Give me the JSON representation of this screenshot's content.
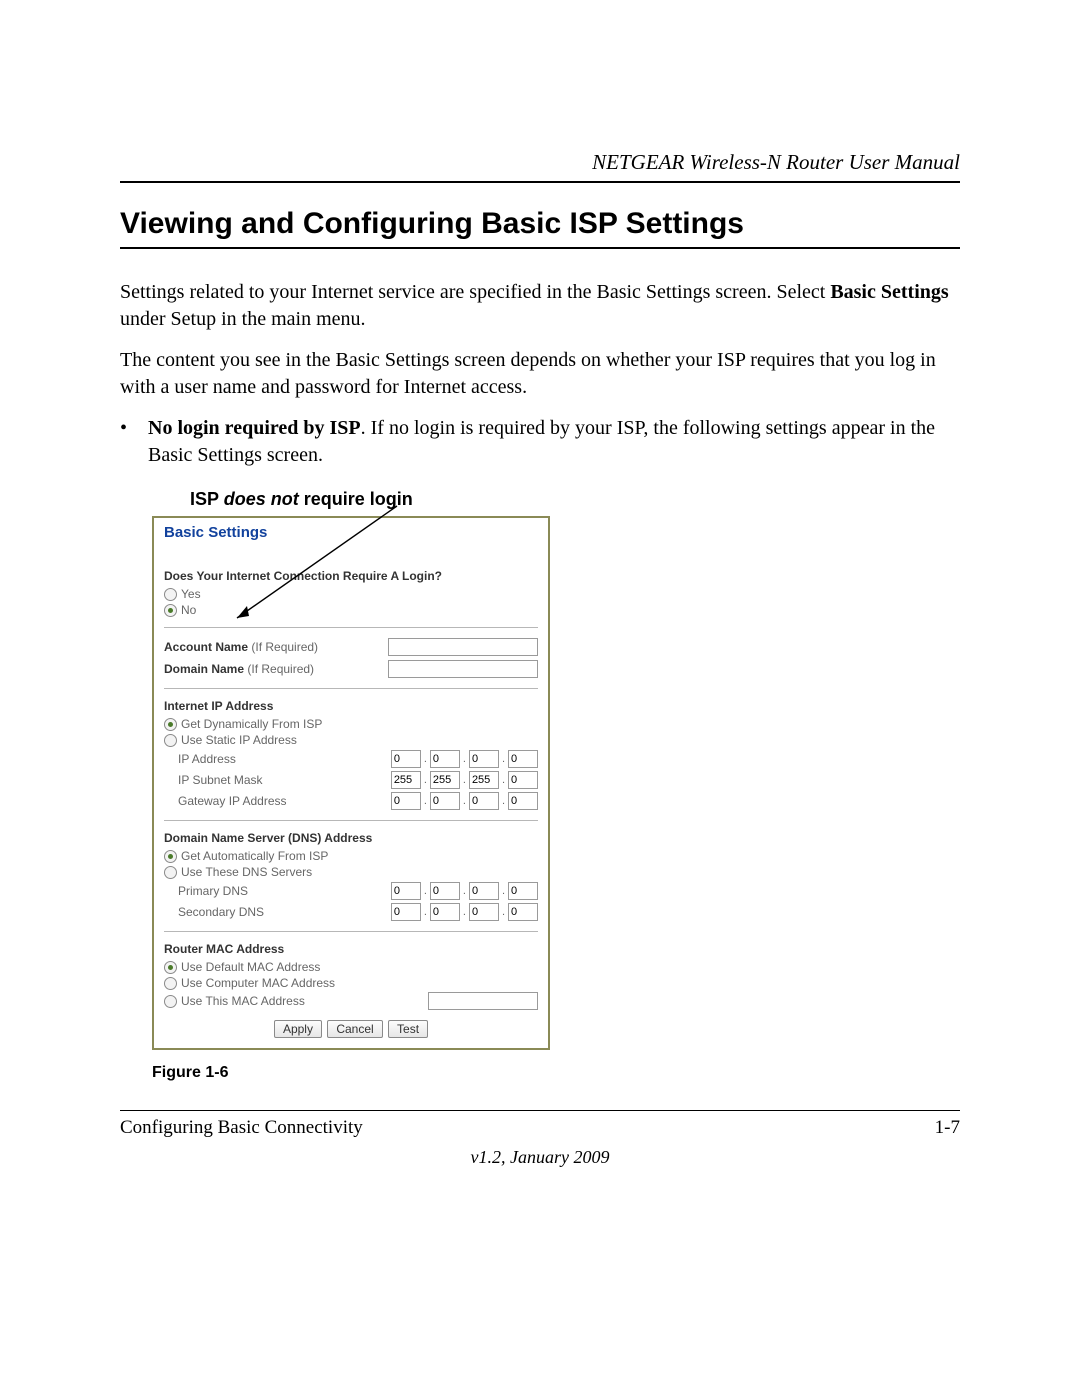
{
  "header": {
    "title": "NETGEAR Wireless-N Router User Manual"
  },
  "section": {
    "heading": "Viewing and Configuring Basic ISP Settings",
    "p1_a": "Settings related to your Internet service are specified in the Basic Settings screen. Select ",
    "p1_b_bold": "Basic Settings",
    "p1_c": " under Setup in the main menu.",
    "p2": "The content you see in the Basic Settings screen depends on whether your ISP requires that you log in with a user name and password for Internet access.",
    "bullet": {
      "lead_bold": "No login required by ISP",
      "rest": ". If no login is required by your ISP, the following settings appear in the Basic Settings screen."
    },
    "callout_a": "ISP ",
    "callout_em": "does not",
    "callout_b": " require login"
  },
  "panel": {
    "title": "Basic Settings",
    "login_q": "Does Your Internet Connection Require A Login?",
    "opt_yes": "Yes",
    "opt_no": "No",
    "account_label": "Account Name",
    "if_required": " (If Required)",
    "domain_label": "Domain Name",
    "internet_ip_head": "Internet IP Address",
    "opt_dyn_isp": "Get Dynamically From ISP",
    "opt_static_ip": "Use Static IP Address",
    "ip_address_label": "IP Address",
    "ip_subnet_label": "IP Subnet Mask",
    "gateway_label": "Gateway IP Address",
    "ip_addr": [
      "0",
      "0",
      "0",
      "0"
    ],
    "subnet": [
      "255",
      "255",
      "255",
      "0"
    ],
    "gateway": [
      "0",
      "0",
      "0",
      "0"
    ],
    "dns_head": "Domain Name Server (DNS) Address",
    "opt_dns_auto": "Get Automatically From ISP",
    "opt_dns_these": "Use These DNS Servers",
    "primary_dns_label": "Primary DNS",
    "secondary_dns_label": "Secondary DNS",
    "primary_dns": [
      "0",
      "0",
      "0",
      "0"
    ],
    "secondary_dns": [
      "0",
      "0",
      "0",
      "0"
    ],
    "mac_head": "Router MAC Address",
    "opt_mac_default": "Use Default MAC Address",
    "opt_mac_computer": "Use Computer MAC Address",
    "opt_mac_this": "Use This MAC Address",
    "btn_apply": "Apply",
    "btn_cancel": "Cancel",
    "btn_test": "Test"
  },
  "figure_caption": "Figure 1-6",
  "footer": {
    "left": "Configuring Basic Connectivity",
    "right": "1-7",
    "version": "v1.2, January 2009"
  }
}
